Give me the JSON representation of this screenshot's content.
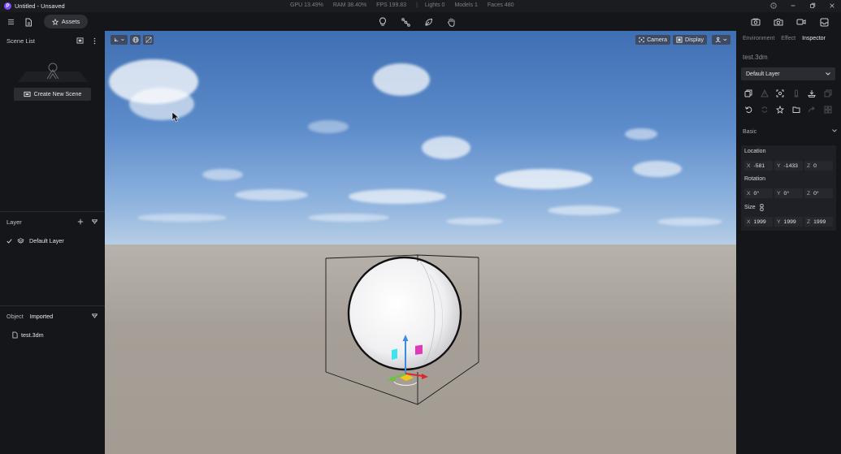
{
  "app": {
    "logo_letter": "P",
    "title": "Untitled - Unsaved"
  },
  "stats": {
    "gpu": "GPU 13.49%",
    "ram": "RAM 38.40%",
    "fps": "FPS 199.83",
    "sep": "|",
    "lights": "Lights 0",
    "models": "Models 1",
    "faces": "Faces 480"
  },
  "toolbar": {
    "assets_label": "Assets",
    "center_icons": [
      "lightbulb-icon",
      "node-path-icon",
      "leaf-icon",
      "hand-icon"
    ],
    "right_icons": [
      "render-camera-icon",
      "photo-camera-icon",
      "video-camera-icon",
      "inbox-icon"
    ]
  },
  "left_panel": {
    "scene_list_title": "Scene List",
    "create_scene_label": "Create New Scene",
    "layer_title": "Layer",
    "layers": [
      {
        "name": "Default Layer",
        "visible": true
      }
    ],
    "object_tab": "Object",
    "imported_tab": "Imported",
    "files": [
      "test.3dm"
    ]
  },
  "viewport": {
    "camera_label": "Camera",
    "display_label": "Display"
  },
  "right_panel": {
    "tabs": [
      "Environment",
      "Effect",
      "Inspector"
    ],
    "active_tab": "Inspector",
    "object_name": "test.3dm",
    "layer_value": "Default Layer",
    "basic_label": "Basic",
    "location_label": "Location",
    "location": {
      "x": "-581",
      "y": "-1433",
      "z": "0"
    },
    "rotation_label": "Rotation",
    "rotation": {
      "x": "0°",
      "y": "0°",
      "z": "0°"
    },
    "size_label": "Size",
    "size": {
      "x": "1999",
      "y": "1999",
      "z": "1999"
    },
    "axis_labels": {
      "x": "X",
      "y": "Y",
      "z": "Z"
    }
  },
  "colors": {
    "accent": "#7b4dff",
    "panel_bg": "#15161a",
    "sky_top": "#3f6fb3",
    "ground": "#a59f97",
    "gizmo_y": "#3b8be0",
    "gizmo_x": "#e0242c",
    "gizmo_z": "#63c833",
    "plane_cyan": "#3fe3f0",
    "plane_magenta": "#e03ab7",
    "plane_yellow": "#f0c816"
  }
}
